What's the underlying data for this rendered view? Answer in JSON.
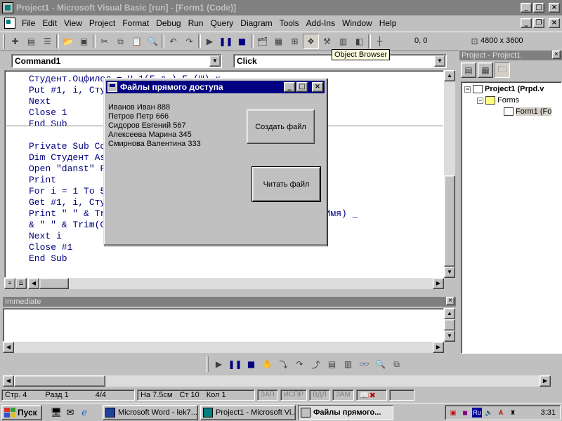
{
  "window": {
    "title": "Project1 - Microsoft Visual Basic [run] - [Form1 (Code)]"
  },
  "menu": {
    "items": [
      "File",
      "Edit",
      "View",
      "Project",
      "Format",
      "Debug",
      "Run",
      "Query",
      "Diagram",
      "Tools",
      "Add-Ins",
      "Window",
      "Help"
    ]
  },
  "toolbar": {
    "position": "0, 0",
    "size": "4800 x 3600",
    "tooltip": "Object Browser"
  },
  "code": {
    "object_combo": "Command1",
    "procedure_combo": "Click",
    "lines": [
      "Студент.Оцфилол = Н.1(Г.д.) Б.(Ш) х",
      "Put #1, i, Студент",
      "Next",
      "Close 1",
      "End Sub",
      "Private Sub Command2_Click()",
      "Dim Студент As",
      "Open \"danst\" Fo",
      "Print",
      "For i = 1 To 5",
      "Get #1, i, Студ",
      "Print \" \" & Tr",
      "& \" \" & Trim(Ст",
      "Next i",
      "Close #1",
      "End Sub"
    ],
    "line_tail": "т.Имя) _"
  },
  "form": {
    "title": "Файлы прямого доступа",
    "list": [
      "Иванов Иван 888",
      "Петров Петр 666",
      "Сидоров Евгений 567",
      "Алексеева Марина 345",
      "Смирнова Валентина 333"
    ],
    "create_button": "Создать файл",
    "read_button": "Читать файл"
  },
  "project": {
    "title": "Project - Project1",
    "root": "Project1 (Prpd.v",
    "folder": "Forms",
    "form": "Form1 (Fo"
  },
  "immediate": {
    "title": "Immediate"
  },
  "status": {
    "page": "Стр. 4",
    "section": "Разд 1",
    "pages": "4/4",
    "at": "На 7.5см",
    "line": "Ст 10",
    "col": "Кол 1",
    "rec": "ЗАП",
    "trk": "ИСПР",
    "ext": "ВДЛ",
    "ovr": "ЗАМ"
  },
  "taskbar": {
    "start": "Пуск",
    "tasks": [
      "Microsoft Word - lek7...",
      "Project1 - Microsoft Vi...",
      "Файлы прямого..."
    ],
    "lang": "Ru",
    "clock": "3:31"
  },
  "colors": {
    "active_title": "#000080",
    "inactive_title": "#808080",
    "code_text": "#000080",
    "face": "#c0c0c0"
  }
}
